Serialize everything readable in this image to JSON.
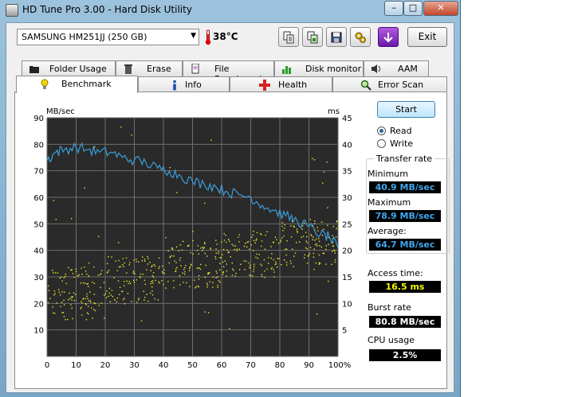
{
  "window": {
    "title": "HD Tune Pro 3.00 - Hard Disk Utility",
    "min_glyph": "–",
    "max_glyph": "□",
    "close_glyph": "✕"
  },
  "toolbar": {
    "drive": "SAMSUNG HM251JJ (250 GB)",
    "temperature": "38°C",
    "exit_label": "Exit",
    "icons": [
      "copy-text-icon",
      "copy-screenshot-icon",
      "save-icon",
      "options-icon",
      "download-icon"
    ]
  },
  "tabs": {
    "row1": [
      {
        "label": "Folder Usage",
        "icon": "folder-icon"
      },
      {
        "label": "Erase",
        "icon": "trash-icon"
      },
      {
        "label": "File Benchmark",
        "icon": "file-benchmark-icon"
      },
      {
        "label": "Disk monitor",
        "icon": "disk-monitor-icon"
      },
      {
        "label": "AAM",
        "icon": "speaker-icon"
      }
    ],
    "row2": [
      {
        "label": "Benchmark",
        "icon": "lightbulb-icon",
        "active": true
      },
      {
        "label": "Info",
        "icon": "info-icon"
      },
      {
        "label": "Health",
        "icon": "health-cross-icon"
      },
      {
        "label": "Error Scan",
        "icon": "magnifier-icon"
      }
    ]
  },
  "controls": {
    "start_label": "Start",
    "read_label": "Read",
    "write_label": "Write",
    "selected": "Read"
  },
  "results": {
    "transfer_rate_title": "Transfer rate",
    "minimum_label": "Minimum",
    "minimum_value": "40.9 MB/sec",
    "maximum_label": "Maximum",
    "maximum_value": "78.9 MB/sec",
    "average_label": "Average:",
    "average_value": "64.7 MB/sec",
    "access_label": "Access time:",
    "access_value": "16.5 ms",
    "burst_label": "Burst rate",
    "burst_value": "80.8 MB/sec",
    "cpu_label": "CPU usage",
    "cpu_value": "2.5%"
  },
  "chart_data": {
    "type": "line",
    "left_unit": "MB/sec",
    "right_unit": "ms",
    "xlim": [
      0,
      100
    ],
    "ylim_left": [
      0,
      90
    ],
    "ylim_right": [
      0,
      45
    ],
    "x_ticks": [
      "0",
      "10",
      "20",
      "30",
      "40",
      "50",
      "60",
      "70",
      "80",
      "90",
      "100%"
    ],
    "y_left_ticks": [
      "10",
      "20",
      "30",
      "40",
      "50",
      "60",
      "70",
      "80",
      "90"
    ],
    "y_right_ticks": [
      "5",
      "10",
      "15",
      "20",
      "25",
      "30",
      "35",
      "40",
      "45"
    ],
    "grid": true,
    "background_color": "#2a2a2a",
    "series": [
      {
        "kind": "transfer-rate-line",
        "axis": "left",
        "color": "#3a9ddc",
        "x": [
          0,
          3,
          6,
          10,
          14,
          18,
          22,
          26,
          30,
          34,
          38,
          42,
          46,
          50,
          54,
          58,
          62,
          66,
          70,
          74,
          78,
          82,
          86,
          90,
          94,
          97,
          100
        ],
        "y": [
          74,
          77,
          78,
          78.9,
          78,
          77,
          77,
          75,
          74,
          73,
          71,
          70,
          68,
          66,
          65,
          64,
          62,
          61,
          60,
          57,
          55,
          53,
          51,
          49,
          46,
          45,
          40.9
        ]
      },
      {
        "kind": "access-time-scatter",
        "axis": "right",
        "color": "#e8ec30",
        "description_bands": [
          {
            "x": [
              0,
              20
            ],
            "y": [
              7,
              17
            ]
          },
          {
            "x": [
              20,
              40
            ],
            "y": [
              10,
              19
            ]
          },
          {
            "x": [
              40,
              60
            ],
            "y": [
              13,
              22
            ]
          },
          {
            "x": [
              60,
              80
            ],
            "y": [
              15,
              24
            ]
          },
          {
            "x": [
              80,
              100
            ],
            "y": [
              17,
              26
            ]
          }
        ],
        "average_ms": 16.5
      }
    ]
  }
}
